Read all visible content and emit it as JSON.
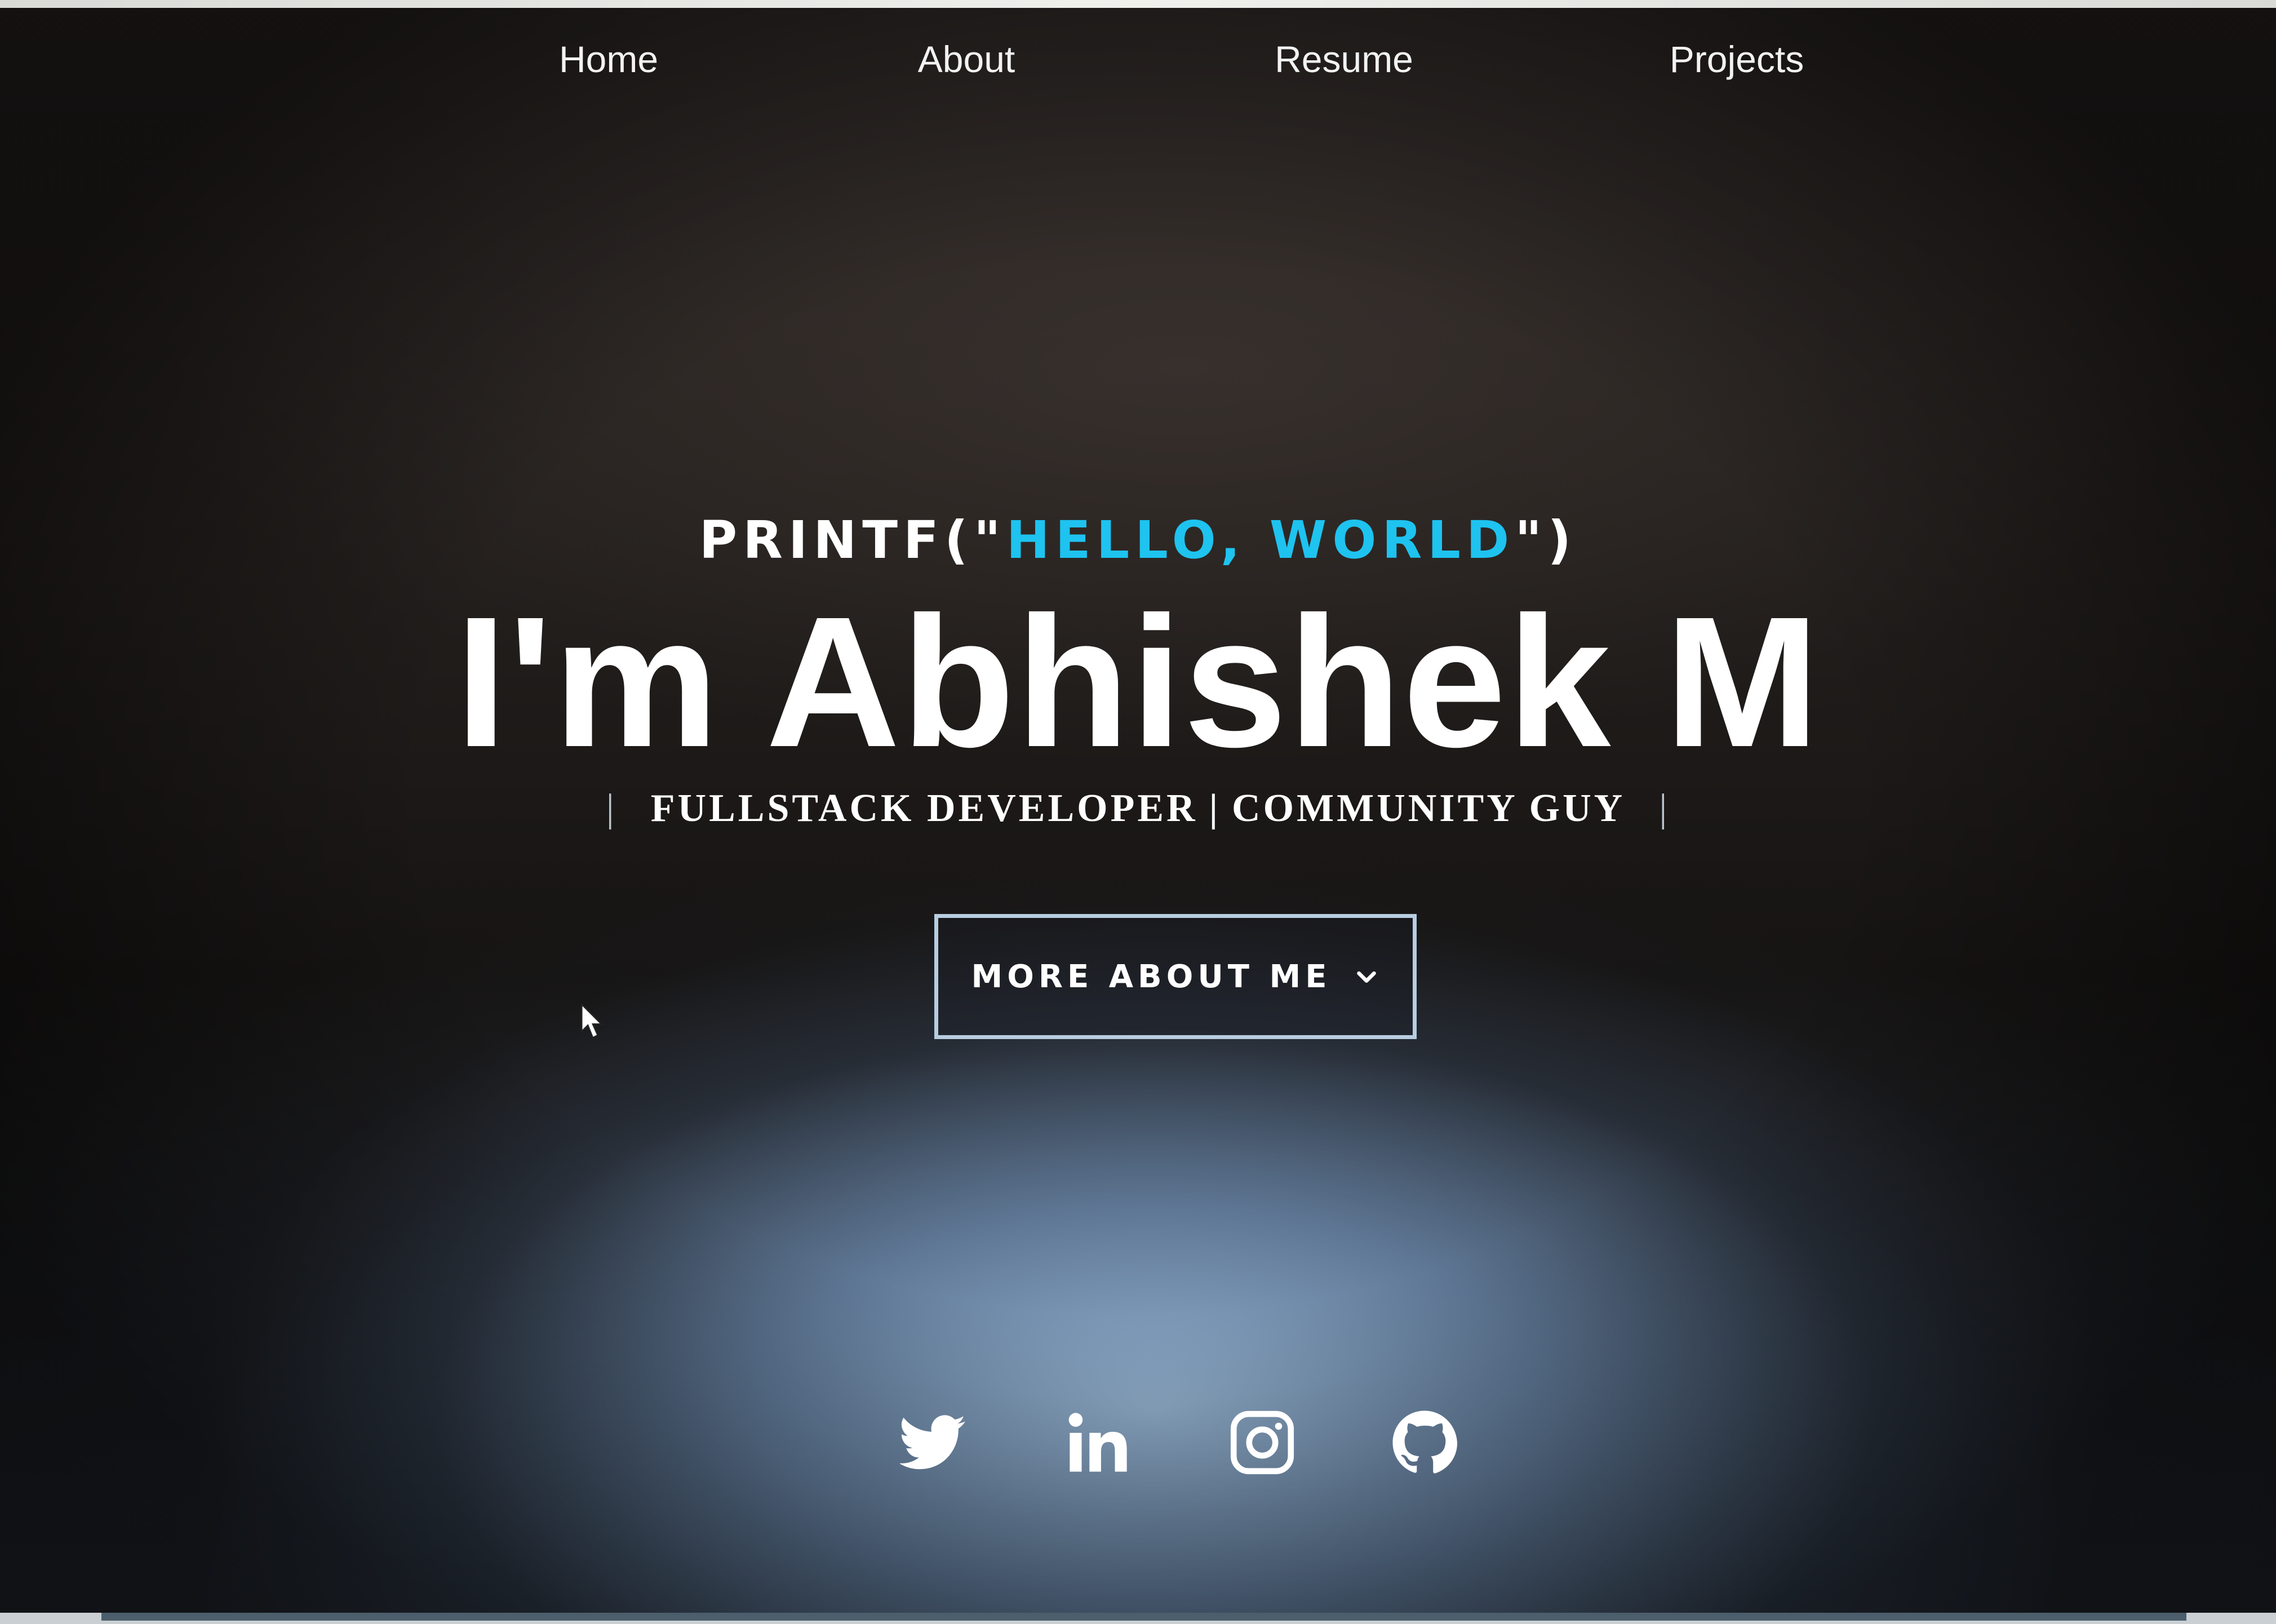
{
  "nav": {
    "items": [
      {
        "label": "Home"
      },
      {
        "label": "About"
      },
      {
        "label": "Resume"
      },
      {
        "label": "Projects"
      }
    ]
  },
  "hero": {
    "printf_prefix": "PRINTF(\"",
    "printf_accent": "HELLO, WORLD",
    "printf_suffix": "\")",
    "name": "I'm Abhishek M",
    "role_sep": "|",
    "role_1": "FULLSTACK DEVELOPER",
    "role_2": "COMMUNITY GUY",
    "accent_color": "#1ec3f0",
    "cta_label": "MORE ABOUT ME",
    "cta_icon": "chevron-down-icon"
  },
  "socials": [
    {
      "name": "twitter-icon"
    },
    {
      "name": "linkedin-icon"
    },
    {
      "name": "instagram-icon"
    },
    {
      "name": "github-icon"
    }
  ]
}
